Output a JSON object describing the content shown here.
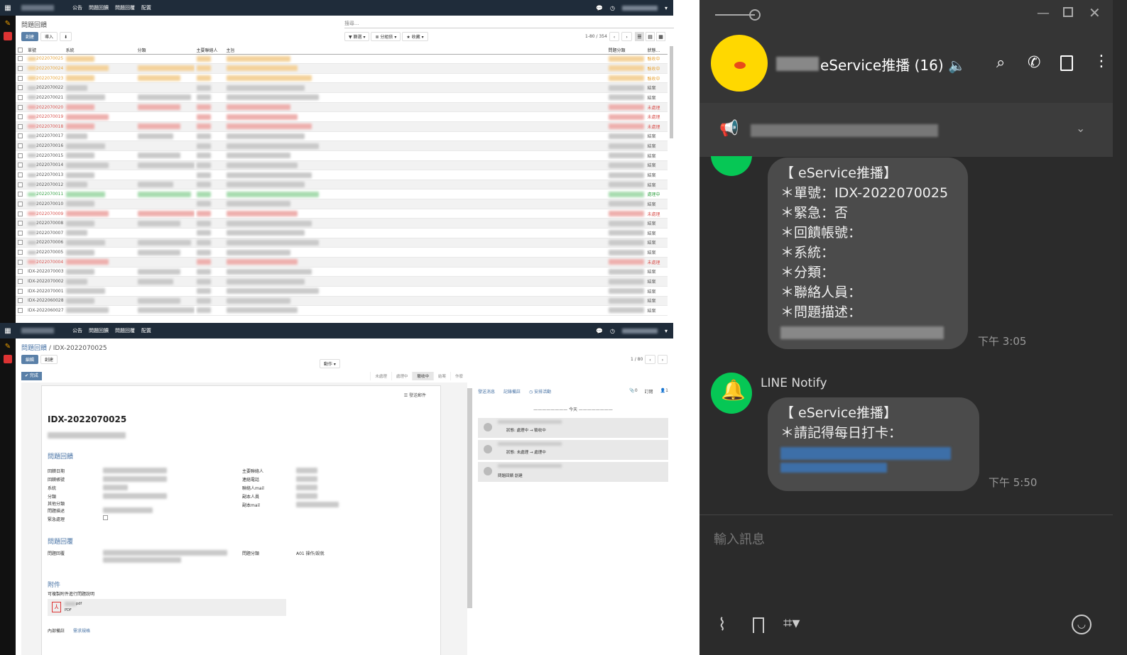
{
  "top_app": {
    "nav": {
      "menu": [
        "公告",
        "問題回饋",
        "問題回覆",
        "配置"
      ]
    },
    "breadcrumb": "問題回饋",
    "search_placeholder": "搜尋...",
    "buttons": {
      "create": "創建",
      "import": "導入"
    },
    "filters": [
      "篩選",
      "分組依",
      "收藏"
    ],
    "pager": "1-80 / 354",
    "columns": [
      "單號",
      "系統",
      "分類",
      "主要聯絡人",
      "主旨",
      "問題分類",
      "狀態..."
    ],
    "rows": [
      {
        "id": "2022070025",
        "status": "驗收中",
        "cls": "s-orange"
      },
      {
        "id": "2022070024",
        "status": "驗收中",
        "cls": "s-orange"
      },
      {
        "id": "2022070023",
        "status": "驗收中",
        "cls": "s-orange"
      },
      {
        "id": "2022070022",
        "status": "結案",
        "cls": "s-dark"
      },
      {
        "id": "2022070021",
        "status": "結案",
        "cls": "s-dark"
      },
      {
        "id": "2022070020",
        "status": "未處理",
        "cls": "s-red"
      },
      {
        "id": "2022070019",
        "status": "未處理",
        "cls": "s-red"
      },
      {
        "id": "2022070018",
        "status": "未處理",
        "cls": "s-red"
      },
      {
        "id": "2022070017",
        "status": "結案",
        "cls": "s-dark"
      },
      {
        "id": "2022070016",
        "status": "結案",
        "cls": "s-dark"
      },
      {
        "id": "2022070015",
        "status": "結案",
        "cls": "s-dark"
      },
      {
        "id": "2022070014",
        "status": "結案",
        "cls": "s-dark"
      },
      {
        "id": "2022070013",
        "status": "結案",
        "cls": "s-dark"
      },
      {
        "id": "2022070012",
        "status": "結案",
        "cls": "s-dark"
      },
      {
        "id": "2022070011",
        "status": "處理中",
        "cls": "s-green"
      },
      {
        "id": "2022070010",
        "status": "結案",
        "cls": "s-dark"
      },
      {
        "id": "2022070009",
        "status": "未處理",
        "cls": "s-red"
      },
      {
        "id": "2022070008",
        "status": "結案",
        "cls": "s-dark"
      },
      {
        "id": "2022070007",
        "status": "結案",
        "cls": "s-dark"
      },
      {
        "id": "2022070006",
        "status": "結案",
        "cls": "s-dark"
      },
      {
        "id": "2022070005",
        "status": "結案",
        "cls": "s-dark"
      },
      {
        "id": "2022070004",
        "status": "未處理",
        "cls": "s-red"
      },
      {
        "id": "IDX-2022070003",
        "status": "結案",
        "cls": "s-dark"
      },
      {
        "id": "IDX-2022070002",
        "status": "結案",
        "cls": "s-dark"
      },
      {
        "id": "IDX-2022070001",
        "status": "結案",
        "cls": "s-dark"
      },
      {
        "id": "IDX-2022060028",
        "status": "結案",
        "cls": "s-dark"
      },
      {
        "id": "IDX-2022060027",
        "status": "結案",
        "cls": "s-dark"
      }
    ]
  },
  "bottom_app": {
    "breadcrumb_root": "問題回饋",
    "breadcrumb_sep": " / ",
    "breadcrumb_current": "IDX-2022070025",
    "buttons": {
      "edit": "編輯",
      "create": "創建",
      "action": "動作",
      "done": "✔ 完成"
    },
    "pager": "1 / 80",
    "stages": [
      "未處理",
      "處理中",
      "驗收中",
      "結案",
      "作廢"
    ],
    "current_stage": "驗收中",
    "attach_btn": "發送郵件",
    "record_id": "IDX-2022070025",
    "section1": "問題回饋",
    "fields_left": [
      "回饋日期",
      "回饋帳號",
      "系統",
      "分類",
      "其他分類",
      "問題描述",
      "緊急處理"
    ],
    "fields_right": [
      "主要聯絡人",
      "連絡電話",
      "聯絡人mail",
      "副本人員",
      "副本mail"
    ],
    "section2": "問題回覆",
    "reply_label": "問題回覆",
    "reply_cat_label": "問題分類",
    "reply_cat_value": "A01 操作/設就",
    "section3": "附件",
    "attach_hint": "可複製附件進行問題說明",
    "pdf_ext": "pdf",
    "pdf_type": "PDF",
    "tabs": [
      "內部備註",
      "需求規格"
    ],
    "chatter": {
      "send": "發送消息",
      "log": "記錄備註",
      "activity": "◷ 安排活動",
      "count": "0",
      "follow": "訂閱",
      "followers": "1",
      "today": "今天",
      "msgs": [
        "狀態: 處理中 → 驗收中",
        "狀態: 未處理 → 處理中",
        "問題回饋 創建"
      ]
    }
  },
  "line": {
    "title": "eService推播",
    "count": "(16)",
    "msg1": {
      "header": "【 eService推播】",
      "lines": [
        "＊單號：IDX-2022070025",
        "＊緊急：否",
        "＊回饋帳號：",
        "＊系統：",
        "＊分類：",
        "＊聯絡人員：",
        "＊問題描述："
      ],
      "time": "下午 3:05"
    },
    "sender": "LINE Notify",
    "msg2": {
      "header": "【 eService推播】",
      "lines": [
        "＊請記得每日打卡："
      ],
      "time": "下午 5:50"
    },
    "input_placeholder": "輸入訊息"
  }
}
